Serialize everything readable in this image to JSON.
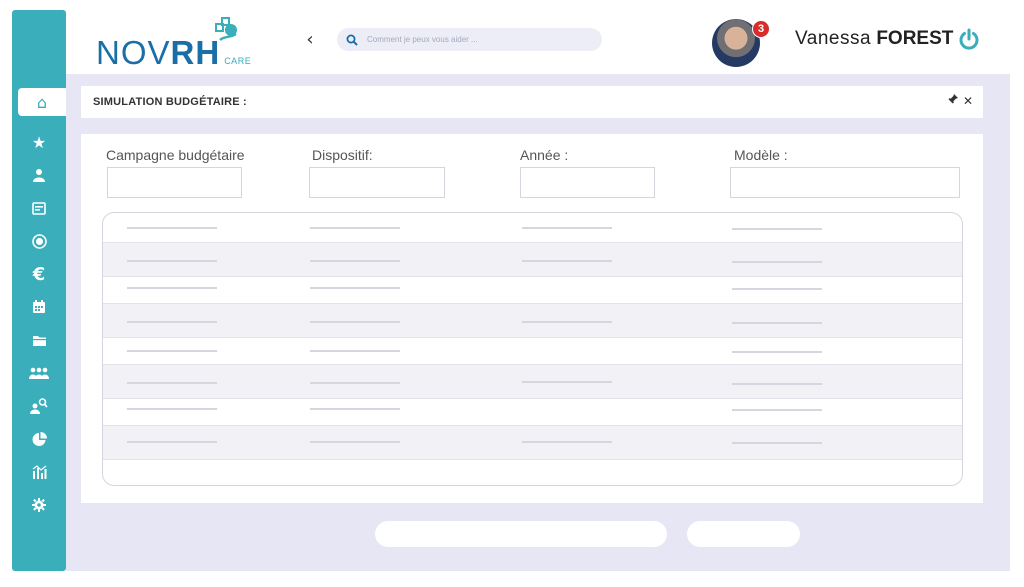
{
  "header": {
    "logo_main_thin": "NOV",
    "logo_main_bold": "RH",
    "logo_sub": "CARE",
    "search_placeholder": "Comment je peux vous aider ...",
    "notification_count": "3",
    "user_first_name": "Vanessa",
    "user_last_name": "FOREST"
  },
  "sidebar": {
    "items": [
      {
        "icon": "home-icon",
        "active": true
      },
      {
        "icon": "star-icon"
      },
      {
        "icon": "user-icon"
      },
      {
        "icon": "card-icon"
      },
      {
        "icon": "target-icon"
      },
      {
        "icon": "euro-icon"
      },
      {
        "icon": "calendar-icon"
      },
      {
        "icon": "folder-icon"
      },
      {
        "icon": "team-icon"
      },
      {
        "icon": "user-search-icon"
      },
      {
        "icon": "pie-chart-icon"
      },
      {
        "icon": "stats-icon"
      },
      {
        "icon": "gear-icon"
      }
    ]
  },
  "page": {
    "title": "SIMULATION BUDGÉTAIRE :",
    "pin_glyph": "📌",
    "close_glyph": "✕"
  },
  "form": {
    "campagne_label": "Campagne budgétaire",
    "dispositif_label": "Dispositif:",
    "annee_label": "Année :",
    "modele_label": "Modèle :"
  },
  "colors": {
    "brand_teal": "#3aaebb",
    "brand_blue": "#1b6fa7",
    "background": "#e6e6f4",
    "badge_red": "#d62c2c"
  }
}
